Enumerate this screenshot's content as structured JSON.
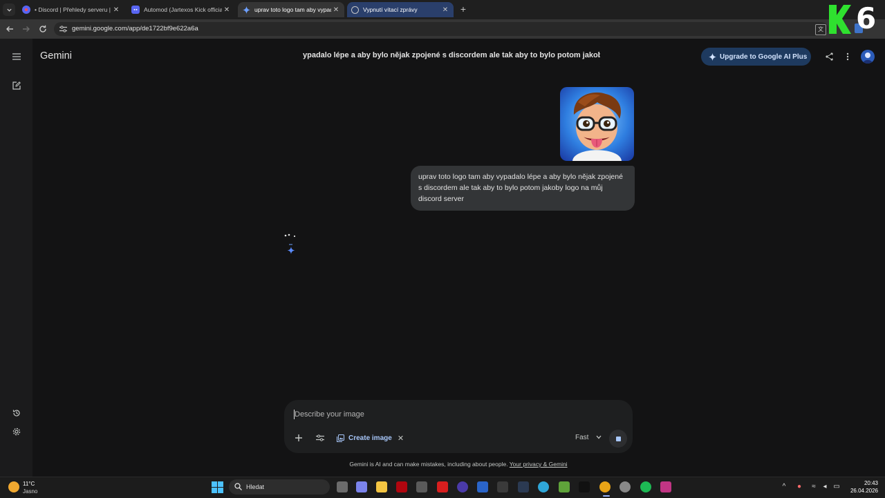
{
  "browser": {
    "tabs": [
      {
        "title": "• Discord | Přehledy serveru | Ja",
        "active": false
      },
      {
        "title": "Automod (Jartexos Kick official",
        "active": false
      },
      {
        "title": "uprav toto logo tam aby vypad",
        "active": true
      },
      {
        "title": "Vypnutí vítací zprávy",
        "active": false
      }
    ],
    "url": "gemini.google.com/app/de1722bf9e622a6a"
  },
  "overlay": {
    "badge_number": "6"
  },
  "app": {
    "brand": "Gemini",
    "conversation_title": "ypadalo lépe a aby bylo nějak zpojené s discordem ale tak aby to bylo potom jakoby lo",
    "upgrade_label": "Upgrade to Google AI Plus",
    "accent_color": "#a8c7fa"
  },
  "chat": {
    "user_message": "uprav toto logo tam aby vypadalo lépe a aby bylo nějak zpojené s discordem ale tak aby to bylo potom jakoby logo na můj discord server"
  },
  "composer": {
    "placeholder": "Describe your image",
    "tool_chip": "Create image",
    "mode": "Fast"
  },
  "footer": {
    "disclaimer": "Gemini is AI and can make mistakes, including about people.",
    "privacy_link": "Your privacy & Gemini"
  },
  "taskbar": {
    "temperature": "11°C",
    "weather": "Jasno",
    "search_label": "Hledat",
    "time": "20:43",
    "date": "26.04.2026"
  }
}
